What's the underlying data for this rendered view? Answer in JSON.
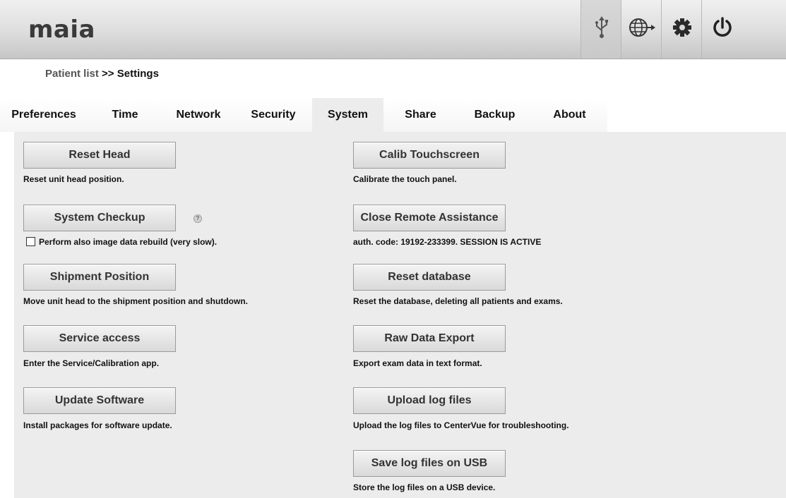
{
  "app": {
    "logo": "maia"
  },
  "topbar": {
    "icons": [
      "usb-icon",
      "network-globe-icon",
      "settings-gear-icon",
      "power-icon"
    ]
  },
  "breadcrumb": {
    "link": "Patient list",
    "separator": ">>",
    "current": "Settings"
  },
  "tabs": [
    {
      "label": "Preferences",
      "active": false
    },
    {
      "label": "Time",
      "active": false
    },
    {
      "label": "Network",
      "active": false
    },
    {
      "label": "Security",
      "active": false
    },
    {
      "label": "System",
      "active": true
    },
    {
      "label": "Share",
      "active": false
    },
    {
      "label": "Backup",
      "active": false
    },
    {
      "label": "About",
      "active": false
    }
  ],
  "left": {
    "reset_head": {
      "label": "Reset Head",
      "desc": "Reset unit head position."
    },
    "system_checkup": {
      "label": "System Checkup",
      "checkbox_label": "Perform also image data rebuild (very slow).",
      "checkbox_checked": false
    },
    "shipment_position": {
      "label": "Shipment Position",
      "desc": "Move unit head to the shipment position and shutdown."
    },
    "service_access": {
      "label": "Service access",
      "desc": "Enter the Service/Calibration app."
    },
    "update_software": {
      "label": "Update Software",
      "desc": "Install packages for software update."
    }
  },
  "right": {
    "calib_touchscreen": {
      "label": "Calib Touchscreen",
      "desc": "Calibrate the touch panel."
    },
    "close_remote": {
      "label": "Close Remote Assistance",
      "desc": "auth. code: 19192-233399. SESSION IS ACTIVE"
    },
    "reset_database": {
      "label": "Reset database",
      "desc": "Reset the database, deleting all patients and exams."
    },
    "raw_data_export": {
      "label": "Raw Data Export",
      "desc": "Export exam data in text format."
    },
    "upload_logs": {
      "label": "Upload log files",
      "desc": "Upload the log files to CenterVue for troubleshooting."
    },
    "save_logs_usb": {
      "label": "Save log files on USB",
      "desc": "Store the log files on a USB device."
    }
  }
}
